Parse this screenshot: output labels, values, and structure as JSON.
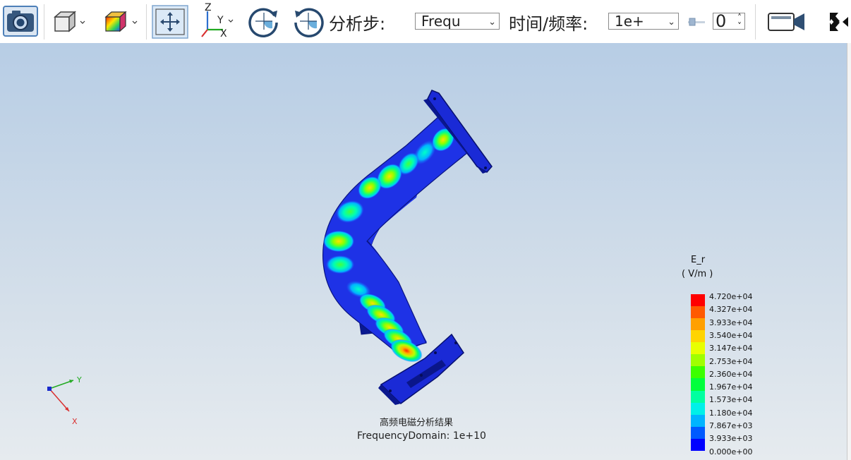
{
  "toolbar": {
    "step_label": "分析步:",
    "step_value": "Frequ",
    "time_label": "时间/频率:",
    "time_value": "1e+",
    "spin_value": "0",
    "axis_labels": {
      "z": "Z",
      "y": "Y",
      "x": "X"
    }
  },
  "icons": [
    "camera-icon",
    "view-cube-icon",
    "contour-display-icon",
    "fit-view-icon",
    "axes-orient-icon",
    "rotate-cw-icon",
    "rotate-ccw-icon",
    "slider-icon",
    "video-camera-icon",
    "fullscreen-icon"
  ],
  "viewport": {
    "caption_title": "高频电磁分析结果",
    "caption_subtitle": "FrequencyDomain: 1e+10",
    "triad": {
      "y": "Y",
      "x": "X"
    }
  },
  "legend": {
    "title": "E_r",
    "unit": "( V/m )",
    "values": [
      "4.720e+04",
      "4.327e+04",
      "3.933e+04",
      "3.540e+04",
      "3.147e+04",
      "2.753e+04",
      "2.360e+04",
      "1.967e+04",
      "1.573e+04",
      "1.180e+04",
      "7.867e+03",
      "3.933e+03",
      "0.000e+00"
    ],
    "colors": [
      "#ff0000",
      "#ff5a00",
      "#ffa000",
      "#ffd400",
      "#e8ff00",
      "#a0ff00",
      "#3cff00",
      "#00ff3c",
      "#00ffa0",
      "#00f0e8",
      "#00b4ff",
      "#005aff",
      "#0000ff"
    ]
  }
}
